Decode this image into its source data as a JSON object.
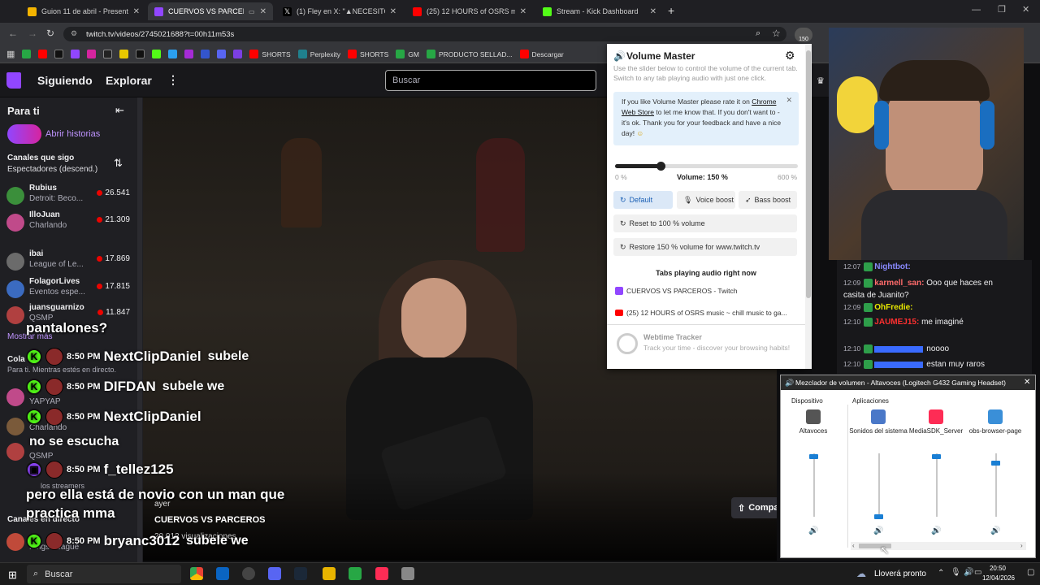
{
  "browser": {
    "tabs": [
      {
        "label": "Guion 11 de abril - Presentación",
        "color": "#f4b400"
      },
      {
        "label": "CUERVOS VS PARCEROS - T",
        "color": "#9146ff"
      },
      {
        "label": "(1) Fley en X: \"▲NECESITO AYU",
        "color": "#000000"
      },
      {
        "label": "(25) 12 HOURS of OSRS mu",
        "color": "#ff0000"
      },
      {
        "label": "Stream - Kick Dashboard",
        "color": "#53fc18"
      }
    ],
    "url": "twitch.tv/videos/2745021688?t=00h11m53s",
    "bookmarks": [
      "SHORTS",
      "Perplexity",
      "SHORTS",
      "GM",
      "PRODUCTO SELLAD...",
      "Descargar"
    ],
    "profile_badge": "150"
  },
  "twitch": {
    "nav": {
      "following": "Siguiendo",
      "explore": "Explorar"
    },
    "search_placeholder": "Buscar",
    "sidebar": {
      "for_you": "Para ti",
      "stories": "Abrir historias",
      "followed_title": "Canales que sigo",
      "followed_sort": "Espectadores (descend.)",
      "channels": [
        {
          "name": "Rubius",
          "game": "Detroit: Beco...",
          "viewers": "26.541",
          "color": "#3b8f3b"
        },
        {
          "name": "IlloJuan",
          "game": "Charlando",
          "viewers": "21.309",
          "color": "#c04a8a"
        },
        {
          "name": "ibai",
          "game": "League of Le...",
          "viewers": "17.869",
          "color": "#6b6b6b"
        },
        {
          "name": "FolagorLives",
          "game": "Eventos espe...",
          "viewers": "17.815",
          "color": "#3b6bc0"
        },
        {
          "name": "juansguarnizo",
          "game": "QSMP",
          "viewers": "11.847",
          "color": "#b04040"
        }
      ],
      "show_more": "Mostrar más",
      "collab_title": "Cola",
      "collab_sub": "Para ti. Mientras estés en directo.",
      "extra": [
        "YAPYAP",
        "Charlando",
        "QSMP",
        "los streamers"
      ],
      "live_title": "Canales en directo",
      "live_game": "Kings League"
    },
    "video": {
      "title": "CUERVOS VS PARCEROS",
      "date": "ayer",
      "views": "20.012 visualizaciones",
      "share": "Compa"
    },
    "overlay": {
      "top_fragment": "pantalones?",
      "rows": [
        {
          "time": "8:50 PM",
          "user": "NextClipDaniel",
          "msg": "subele"
        },
        {
          "time": "8:50 PM",
          "user": "DIFDAN",
          "msg": "subele we"
        },
        {
          "time": "8:50 PM",
          "user": "NextClipDaniel",
          "msg": ""
        },
        {
          "time": "",
          "user": "",
          "msg": "no se escucha"
        },
        {
          "time": "8:50 PM",
          "user": "f_tellez125",
          "msg": ""
        },
        {
          "time": "8:50 PM",
          "user": "bryanc3012",
          "msg": "subele we"
        }
      ],
      "long_msg_1": "pero ella está de novio con un man que",
      "long_msg_2": "practica mma"
    },
    "chat": [
      {
        "time": "12:07",
        "user": "Nightbot:",
        "color": "#8a8aff",
        "msg": ""
      },
      {
        "time": "12:09",
        "user": "karmell_san:",
        "color": "#ff6b6b",
        "msg": "Ooo que haces en casita de Juanito?"
      },
      {
        "time": "12:09",
        "user": "OhFredie:",
        "color": "#e8e800",
        "msg": ""
      },
      {
        "time": "12:10",
        "user": "JAUMEJ15:",
        "color": "#ff3030",
        "msg": "me imaginé"
      },
      {
        "time": "12:10",
        "user": "",
        "color": "#3a6bff",
        "msg": "noooo"
      },
      {
        "time": "12:10",
        "user": "",
        "color": "#3a6bff",
        "msg": "estan muy raros"
      }
    ]
  },
  "volume_master": {
    "title": "Volume Master",
    "subtitle": "Use the slider below to control the volume of the current tab. Switch to any tab playing audio with just one click.",
    "notice_1": "If you like Volume Master please rate it on",
    "notice_link": "Chrome Web Store",
    "notice_2": "to let me know that. If you don't want to - it's ok. Thank you for your feedback and have a nice day!",
    "slider_value": 0.25,
    "min_label": "0 %",
    "max_label": "600 %",
    "volume_label": "Volume: 150 %",
    "modes": [
      "Default",
      "Voice boost",
      "Bass boost"
    ],
    "reset": "Reset to 100 % volume",
    "restore": "Restore 150 % volume for www.twitch.tv",
    "tabs_heading": "Tabs playing audio right now",
    "audio_tabs": [
      "CUERVOS VS PARCEROS - Twitch",
      "(25) 12 HOURS of OSRS music ~ chill music to ga..."
    ],
    "promo_title": "Webtime Tracker",
    "promo_sub": "Track your time - discover your browsing habits!"
  },
  "mixer": {
    "title": "Mezclador de volumen - Altavoces (Logitech G432 Gaming Headset)",
    "device_header": "Dispositivo",
    "apps_header": "Aplicaciones",
    "columns": [
      {
        "label": "Altavoces",
        "level": 0.95,
        "icon_color": "#555555"
      },
      {
        "label": "Sonidos del sistema",
        "level": 0.0,
        "icon_color": "#4a78c8"
      },
      {
        "label": "MediaSDK_Server",
        "level": 0.95,
        "icon_color": "#fe2c55"
      },
      {
        "label": "obs-browser-page",
        "level": 0.85,
        "icon_color": "#3a8fd8"
      }
    ]
  },
  "taskbar": {
    "search": "Buscar",
    "weather": "Lloverá pronto",
    "time": "20:50",
    "date": "12/04/2026"
  }
}
